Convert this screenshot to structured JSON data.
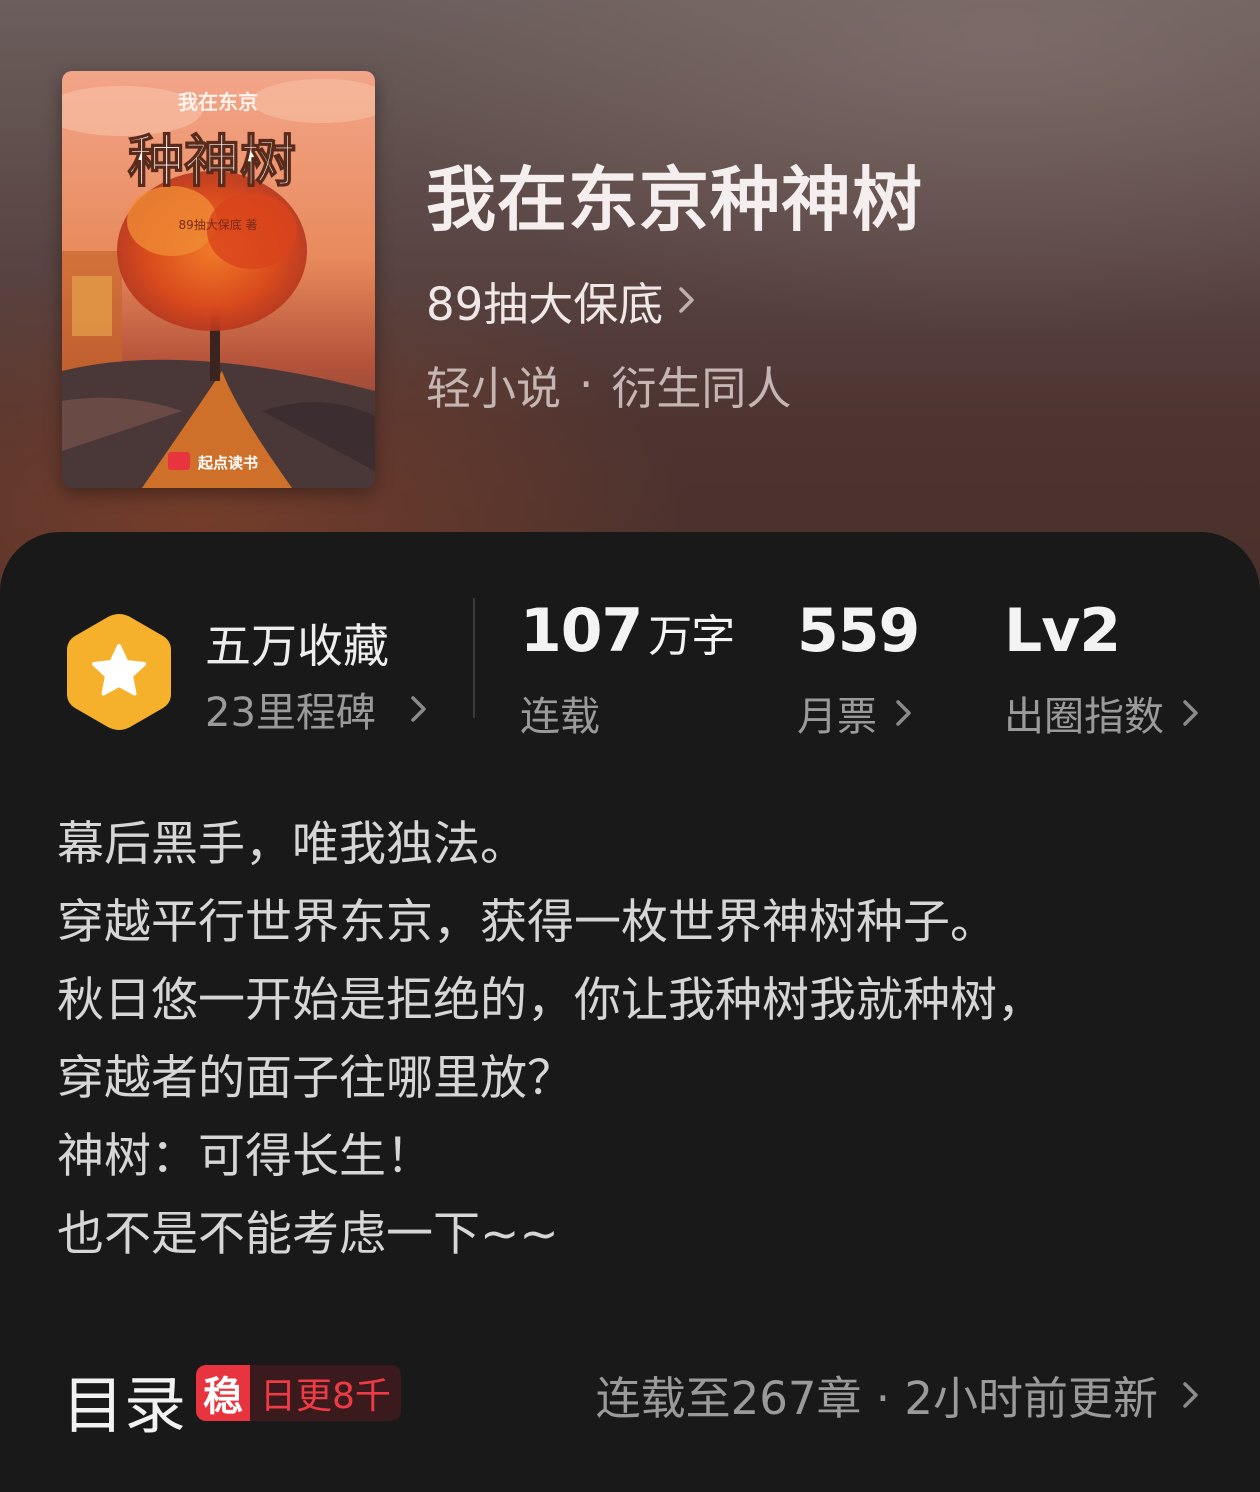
{
  "book": {
    "title": "我在东京种神树",
    "author": "89抽大保底",
    "genre": "轻小说",
    "separator": "·",
    "subgenre": "衍生同人",
    "cover": {
      "small_title": "我在东京",
      "big_title": "种神树",
      "cover_author": "89抽大保底 著",
      "publisher_logo_text": "起点读书"
    }
  },
  "stats": {
    "favorites": {
      "main": "五万收藏",
      "sub": "23里程碑"
    },
    "words": {
      "value": "107",
      "unit": "万字",
      "label": "连载"
    },
    "monthly_tickets": {
      "value": "559",
      "label": "月票"
    },
    "level": {
      "value": "Lv2",
      "label": "出圈指数"
    }
  },
  "synopsis": [
    "幕后黑手，唯我独法。",
    "穿越平行世界东京，获得一枚世界神树种子。",
    "秋日悠一开始是拒绝的，你让我种树我就种树，",
    "穿越者的面子往哪里放？",
    "神树：可得长生！",
    "也不是不能考虑一下~~"
  ],
  "toc": {
    "title": "目录",
    "tag_stamp": "稳",
    "tag_text": "日更8千",
    "status": "连载至267章 · 2小时前更新"
  },
  "colors": {
    "accent_red": "#e8343e",
    "badge_gold": "#f6b12c",
    "card_bg": "#191919"
  },
  "icons": [
    "star-badge-icon",
    "chevron-right-icon"
  ]
}
